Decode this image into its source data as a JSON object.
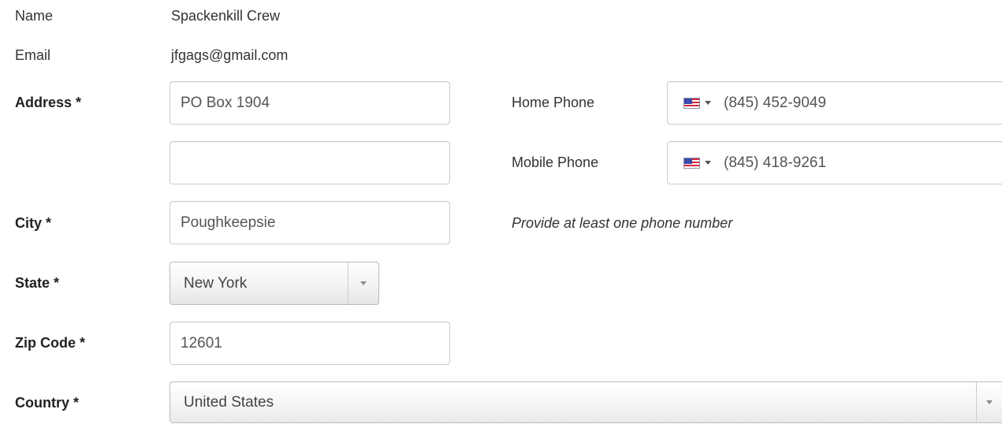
{
  "account": {
    "name_label": "Name",
    "name_value": "Spackenkill Crew",
    "email_label": "Email",
    "email_value": "jfgags@gmail.com"
  },
  "address": {
    "label": "Address *",
    "line1": "PO Box 1904",
    "line2": ""
  },
  "city": {
    "label": "City *",
    "value": "Poughkeepsie"
  },
  "state": {
    "label": "State *",
    "value": "New York"
  },
  "zip": {
    "label": "Zip Code *",
    "value": "12601"
  },
  "country": {
    "label": "Country *",
    "value": "United States"
  },
  "phones": {
    "home_label": "Home Phone",
    "home_value": "(845) 452-9049",
    "mobile_label": "Mobile Phone",
    "mobile_value": "(845) 418-9261",
    "hint": "Provide at least one phone number",
    "flag_icon": "us-flag-icon"
  }
}
